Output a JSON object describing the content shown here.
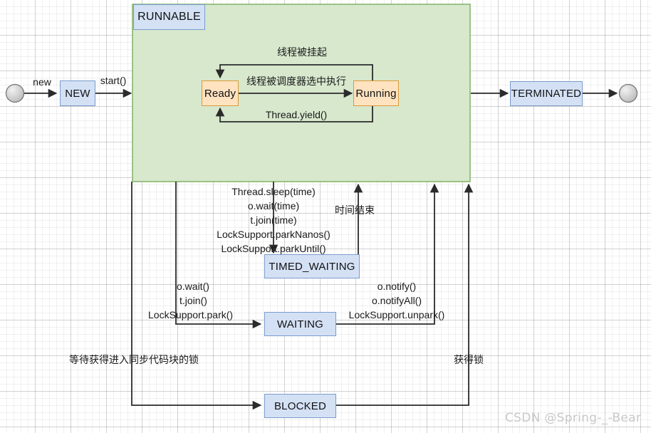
{
  "diagram": {
    "title": "Java Thread State Transition Diagram",
    "colors": {
      "group_fill": "#d7e8cd",
      "group_border": "#82b366",
      "state_fill": "#d4e1f5",
      "state_border": "#7a9ccc",
      "sub_state_fill": "#ffe2bf",
      "sub_state_border": "#d79b3b",
      "edge": "#3a3a3a",
      "watermark": "#c9c9c9"
    },
    "group": {
      "label": "RUNNABLE"
    },
    "nodes": [
      {
        "id": "start",
        "kind": "start-circle",
        "label": ""
      },
      {
        "id": "new",
        "kind": "state",
        "label": "NEW"
      },
      {
        "id": "ready",
        "kind": "sub-state",
        "label": "Ready"
      },
      {
        "id": "running",
        "kind": "sub-state",
        "label": "Running"
      },
      {
        "id": "terminated",
        "kind": "state",
        "label": "TERMINATED"
      },
      {
        "id": "end",
        "kind": "end-circle",
        "label": ""
      },
      {
        "id": "timed_waiting",
        "kind": "state",
        "label": "TIMED_WAITING"
      },
      {
        "id": "waiting",
        "kind": "state",
        "label": "WAITING"
      },
      {
        "id": "blocked",
        "kind": "state",
        "label": "BLOCKED"
      }
    ],
    "edges": [
      {
        "id": "start-to-new",
        "from": "start",
        "to": "new",
        "label": "new"
      },
      {
        "id": "new-to-runnable",
        "from": "new",
        "to": "ready",
        "label": "start()"
      },
      {
        "id": "running-to-ready-suspend",
        "from": "running",
        "to": "ready",
        "label": "线程被挂起"
      },
      {
        "id": "ready-to-running",
        "from": "ready",
        "to": "running",
        "label": "线程被调度器选中执行"
      },
      {
        "id": "running-to-ready-yield",
        "from": "running",
        "to": "ready",
        "label": "Thread.yield()"
      },
      {
        "id": "runnable-to-terminated",
        "from": "running",
        "to": "terminated",
        "label": ""
      },
      {
        "id": "terminated-to-end",
        "from": "terminated",
        "to": "end",
        "label": ""
      },
      {
        "id": "runnable-to-timed-waiting",
        "from": "running",
        "to": "timed_waiting",
        "label_lines": [
          "Thread.sleep(time)",
          "o.wait(time)",
          "t.join(time)",
          "LockSupport.parkNanos()",
          "LockSupport.parkUntil()"
        ]
      },
      {
        "id": "timed-waiting-to-runnable",
        "from": "timed_waiting",
        "to": "running",
        "label": "时间结束"
      },
      {
        "id": "runnable-to-waiting",
        "from": "running",
        "to": "waiting",
        "label_lines": [
          "o.wait()",
          "t.join()",
          "LockSupport.park()"
        ]
      },
      {
        "id": "waiting-to-runnable",
        "from": "waiting",
        "to": "running",
        "label_lines": [
          "o.notify()",
          "o.notifyAll()",
          "LockSupport.unpark()"
        ]
      },
      {
        "id": "runnable-to-blocked",
        "from": "running",
        "to": "blocked",
        "label": "等待获得进入同步代码块的锁"
      },
      {
        "id": "blocked-to-runnable",
        "from": "blocked",
        "to": "running",
        "label": "获得锁"
      }
    ],
    "watermark": "CSDN @Spring-_-Bear"
  }
}
